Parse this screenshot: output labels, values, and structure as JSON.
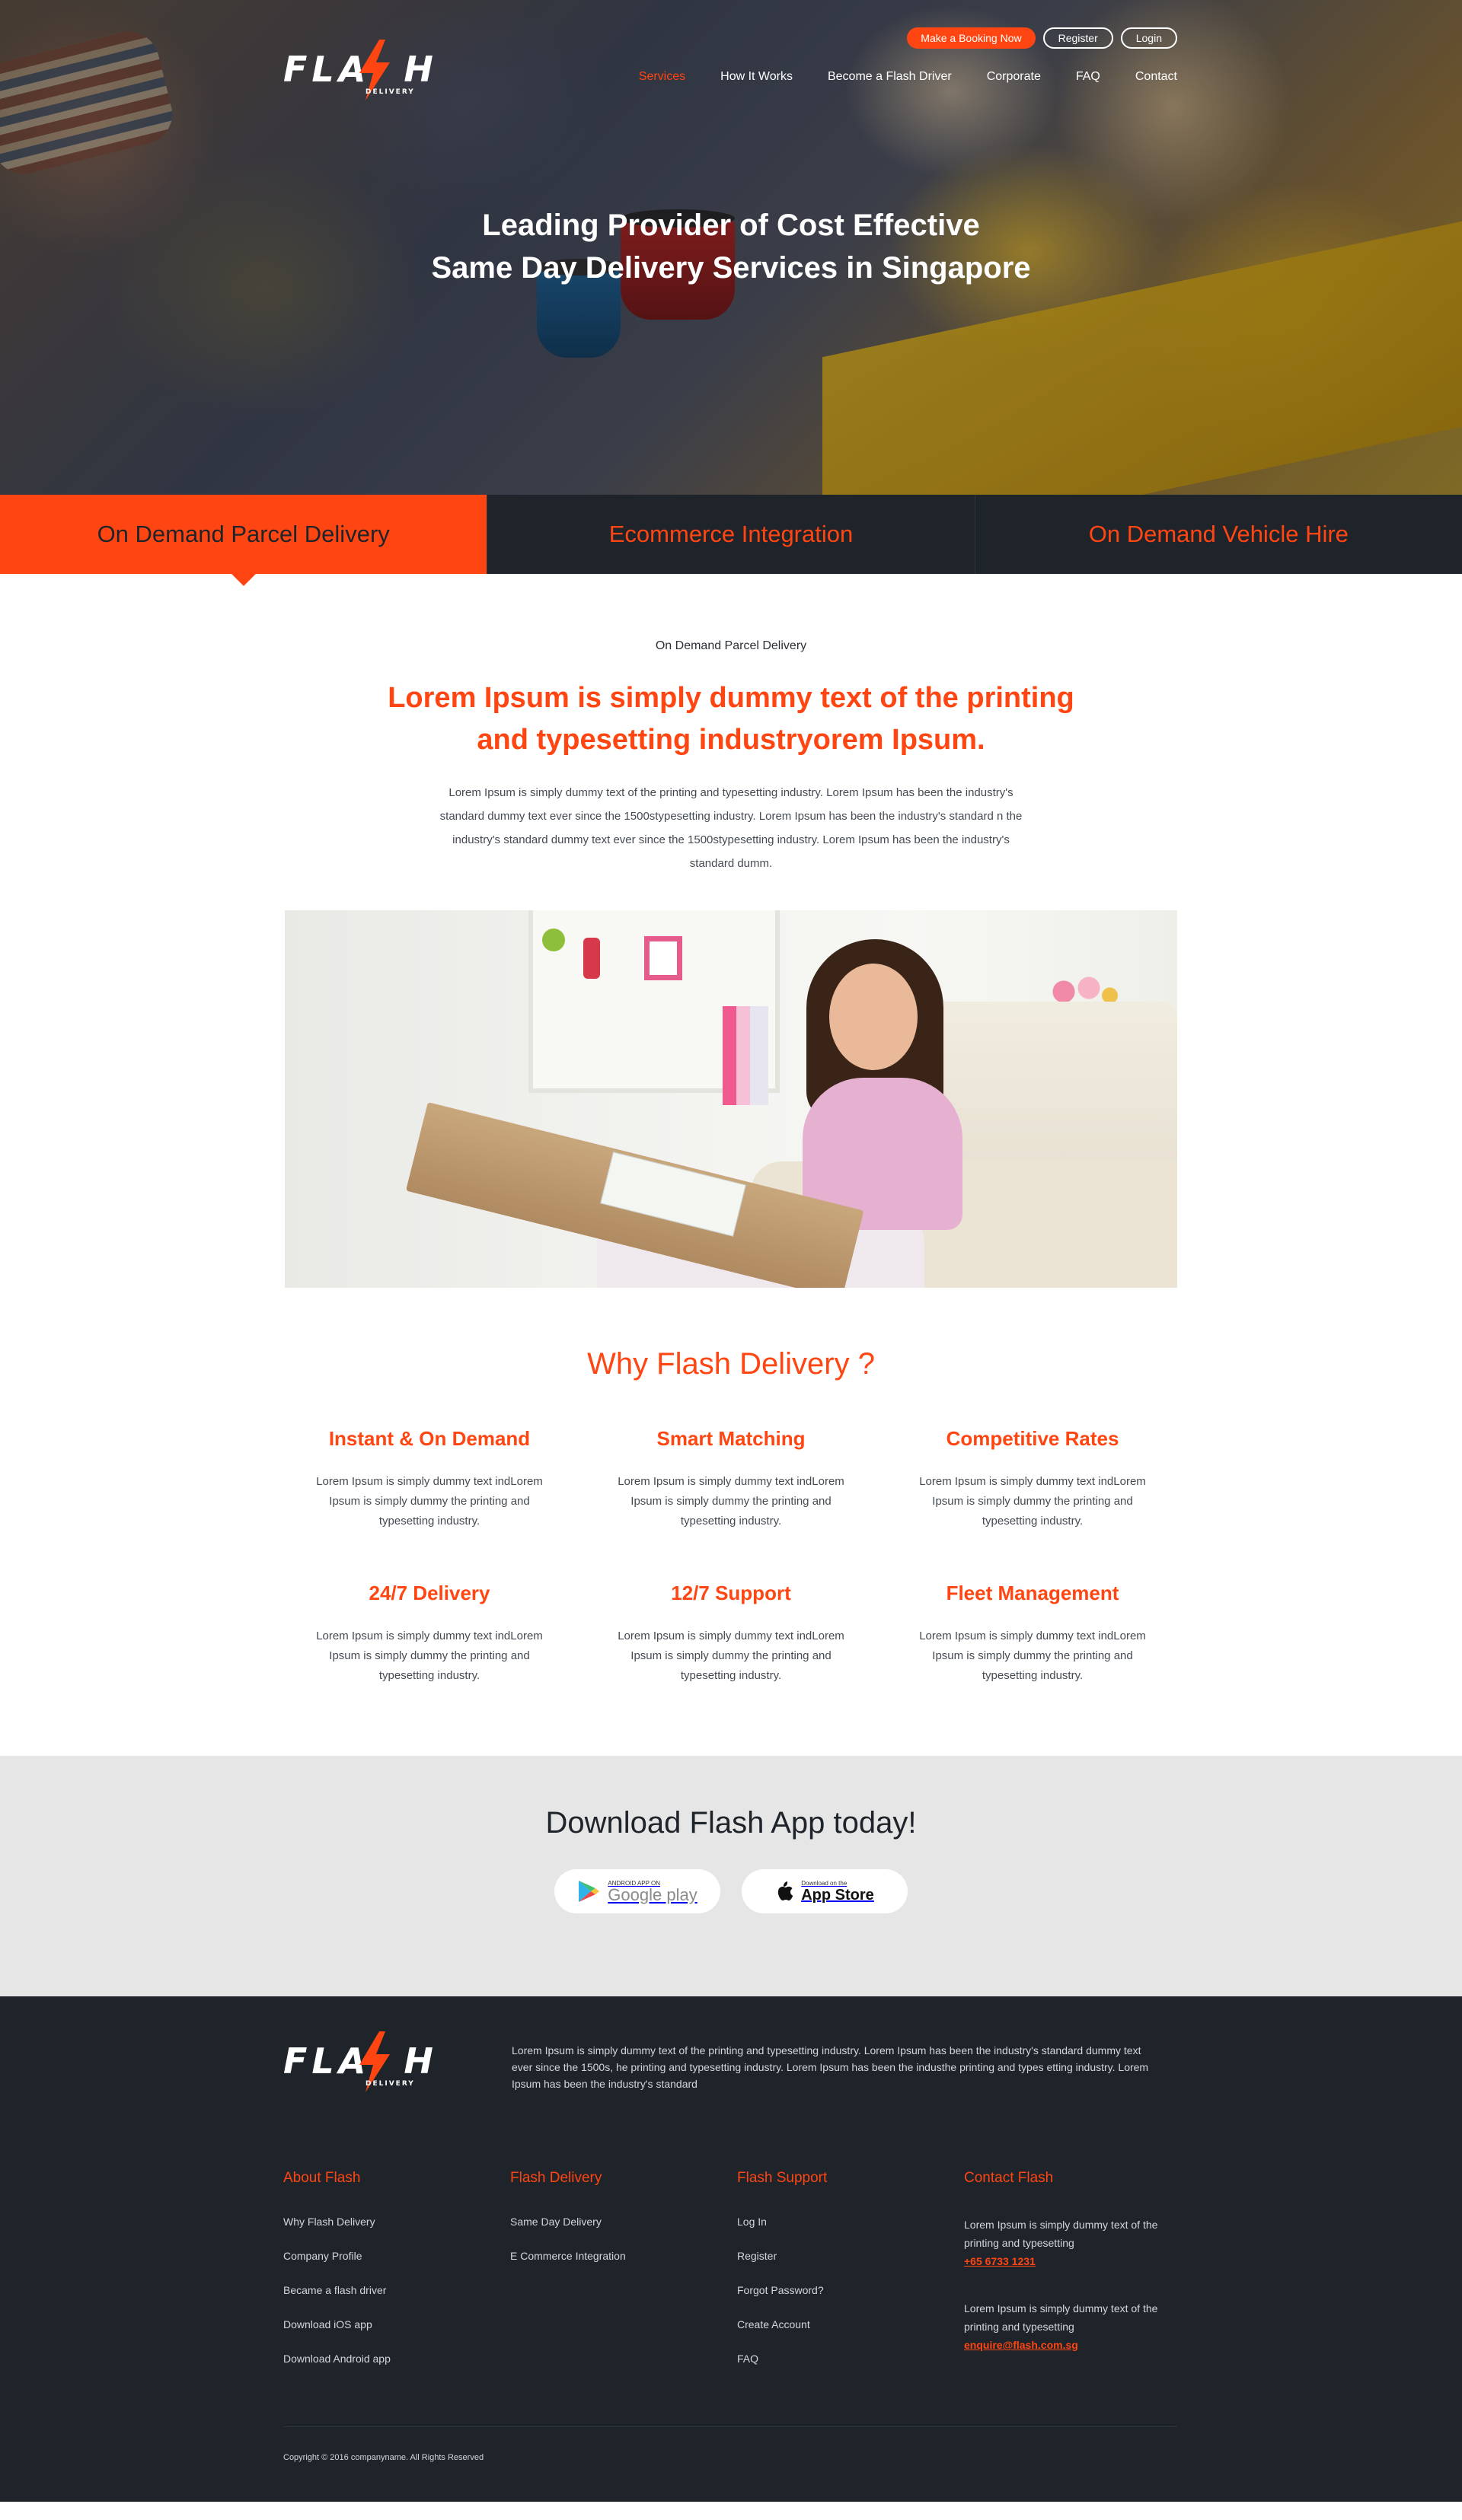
{
  "brand": {
    "name": "FLASH",
    "tagline": "DELIVERY",
    "accent": "#ff4612",
    "dark": "#1f242b"
  },
  "header": {
    "buttons": {
      "booking": "Make a Booking Now",
      "register": "Register",
      "login": "Login"
    },
    "nav": [
      "Services",
      "How It Works",
      "Become a Flash Driver",
      "Corporate",
      "FAQ",
      "Contact"
    ],
    "active_nav": "Services"
  },
  "hero": {
    "line1": "Leading Provider of Cost Effective",
    "line2": "Same Day Delivery Services in Singapore"
  },
  "tabs": [
    "On Demand Parcel Delivery",
    "Ecommerce Integration",
    "On Demand Vehicle Hire"
  ],
  "active_tab": "On Demand Parcel Delivery",
  "intro": {
    "eyebrow": "On Demand Parcel Delivery",
    "headline_1": "Lorem Ipsum is simply dummy text of the printing",
    "headline_2": "and typesetting industryorem Ipsum.",
    "paragraph": "Lorem Ipsum is simply dummy text of the printing and typesetting industry. Lorem Ipsum has been the industry's standard dummy text ever since the 1500stypesetting industry. Lorem Ipsum has been the industry's standard n the industry's standard dummy text ever since the 1500stypesetting industry. Lorem Ipsum has been the industry's standard dumm."
  },
  "why": {
    "title": "Why Flash Delivery ?",
    "features": [
      {
        "title": "Instant & On Demand",
        "text": "Lorem Ipsum is simply dummy text indLorem Ipsum is simply dummy the printing and typesetting industry."
      },
      {
        "title": "Smart Matching",
        "text": "Lorem Ipsum is simply dummy text indLorem Ipsum is simply dummy the printing and typesetting industry."
      },
      {
        "title": "Competitive Rates",
        "text": "Lorem Ipsum is simply dummy text indLorem Ipsum is simply dummy the printing and typesetting industry."
      },
      {
        "title": "24/7 Delivery",
        "text": "Lorem Ipsum is simply dummy text indLorem Ipsum is simply dummy the printing and typesetting industry."
      },
      {
        "title": "12/7 Support",
        "text": "Lorem Ipsum is simply dummy text indLorem Ipsum is simply dummy the printing and typesetting industry."
      },
      {
        "title": "Fleet Management",
        "text": "Lorem Ipsum is simply dummy text indLorem Ipsum is simply dummy the printing and typesetting industry."
      }
    ]
  },
  "app": {
    "title": "Download Flash App today!",
    "google": {
      "small": "ANDROID APP ON",
      "big": "Google play",
      "icon": "google-play-icon"
    },
    "apple": {
      "small": "Download on the",
      "big": "App Store",
      "icon": "apple-icon"
    }
  },
  "footer": {
    "about_text": "Lorem Ipsum is simply dummy text of the printing and typesetting industry. Lorem Ipsum has been the industry's standard dummy text ever since the 1500s, he printing and typesetting industry. Lorem Ipsum has been the industhe printing and types etting industry. Lorem Ipsum has been the industry's standard",
    "columns": [
      {
        "title": "About Flash",
        "links": [
          "Why Flash Delivery",
          "Company Profile",
          "Became a flash driver",
          "Download iOS app",
          "Download Android app"
        ]
      },
      {
        "title": "Flash Delivery",
        "links": [
          "Same Day Delivery",
          "E Commerce Integration"
        ]
      },
      {
        "title": "Flash Support",
        "links": [
          "Log In",
          "Register",
          "Forgot Password?",
          "Create Account",
          "FAQ"
        ]
      }
    ],
    "contact": {
      "title": "Contact Flash",
      "block1_text": "Lorem Ipsum is simply dummy text of the printing and typesetting",
      "phone": "+65 6733 1231",
      "block2_text": "Lorem Ipsum is simply dummy text of the printing and typesetting",
      "email": "enquire@flash.com.sg"
    },
    "copyright": "Copyright © 2016 companyname. All Rights Reserved"
  }
}
